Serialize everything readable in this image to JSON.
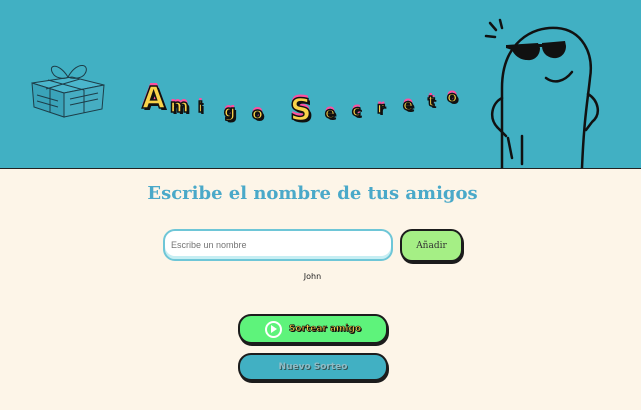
{
  "header": {
    "title": "Amigo Secreto",
    "title_letters": [
      "A",
      "m",
      "i",
      "g",
      "o",
      "S",
      "e",
      "c",
      "r",
      "e",
      "t",
      "o"
    ]
  },
  "main": {
    "subtitle": "Escribe el nombre de tus amigos",
    "name_input": {
      "value": "",
      "placeholder": "Escribe un nombre"
    },
    "add_button_label": "Añadir",
    "friends": [
      "John"
    ],
    "result": "",
    "draw_button_label": "Sortear amigo",
    "new_draw_button_label": "Nuevo Sorteo"
  },
  "icons": {
    "gift": "gift-box-icon",
    "mascot": "sunglasses-mascot-icon",
    "play": "play-circle-icon"
  },
  "colors": {
    "header_bg": "#41b0c3",
    "page_bg": "#fdf5e8",
    "subtitle": "#4aa9c9",
    "add_button": "#a5ef85",
    "draw_button": "#5ef37b",
    "new_draw_button": "#41b0c3",
    "title_fill": "#f9d24a",
    "title_accent": "#ff4ea0"
  }
}
